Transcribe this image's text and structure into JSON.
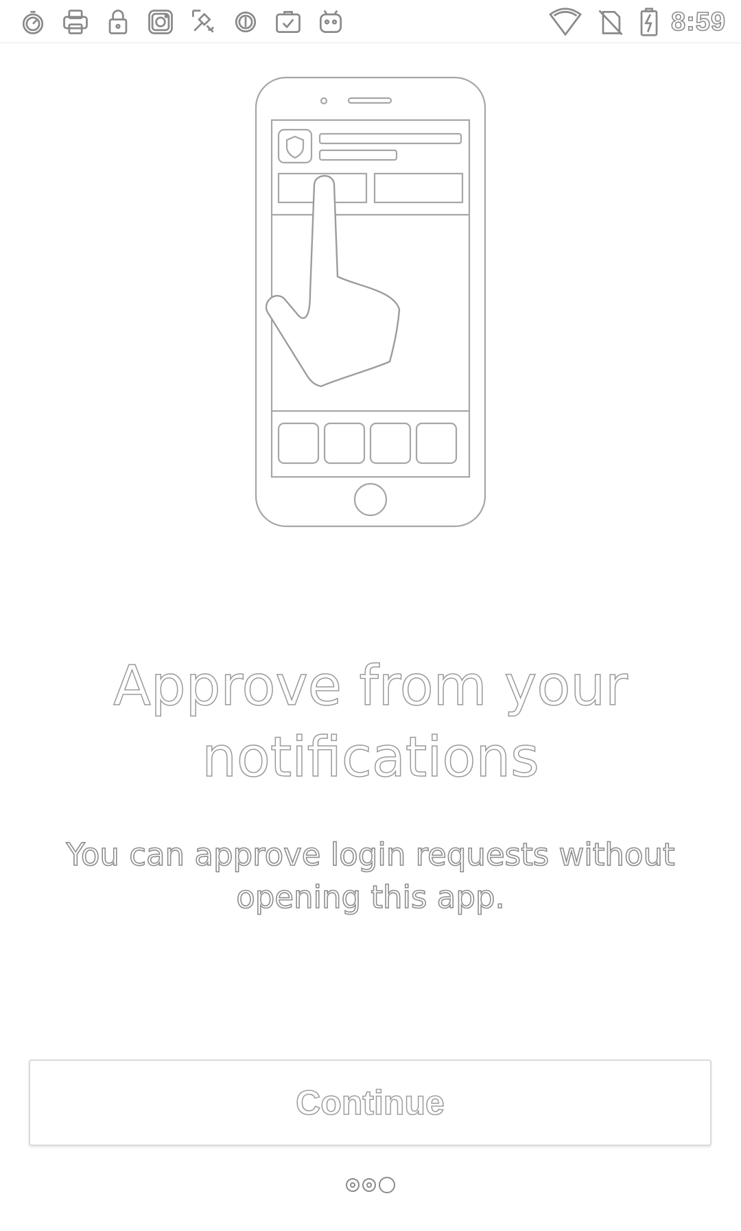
{
  "status_bar": {
    "left_icons": [
      "timer-icon",
      "printer-icon",
      "lock-icon",
      "instagram-icon",
      "satellite-icon",
      "circle-toggle-icon",
      "briefcase-check-icon",
      "android-icon"
    ],
    "right_icons": [
      "wifi-icon",
      "no-sim-icon",
      "battery-charging-icon"
    ],
    "time": "8:59"
  },
  "onboarding": {
    "illustration": "phone-tap-notification-illustration",
    "title_line1": "Approve from your",
    "title_line2": "notifications",
    "subtitle_line1": "You can approve login requests without",
    "subtitle_line2": "opening this app.",
    "continue_label": "Continue",
    "pages_total": 3,
    "current_page": 1
  }
}
